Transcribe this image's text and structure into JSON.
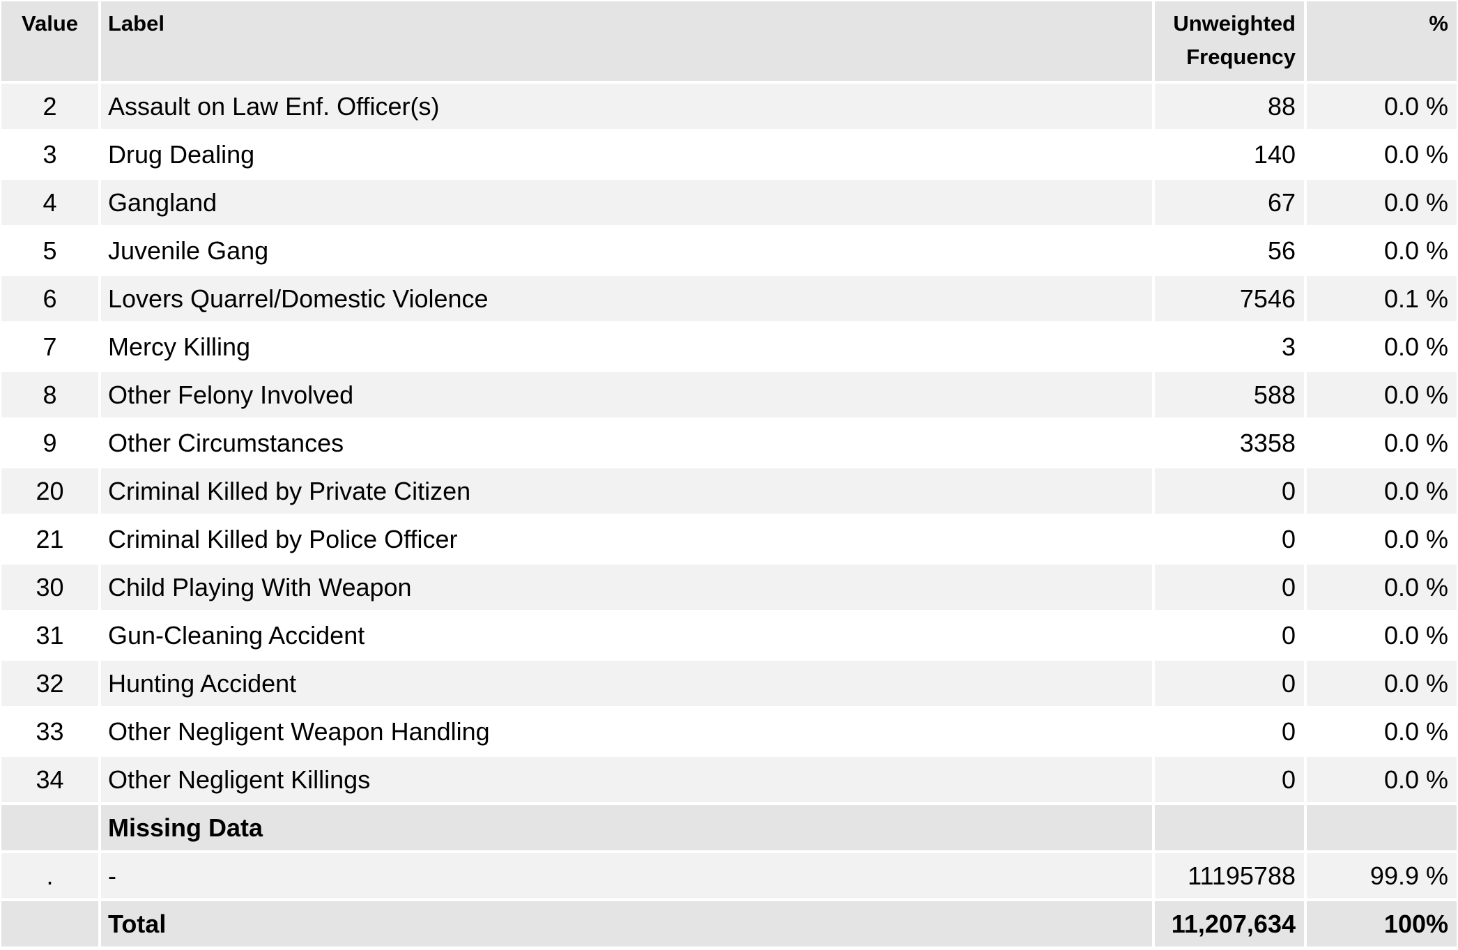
{
  "table": {
    "headers": {
      "value": "Value",
      "label": "Label",
      "frequency_line1": "Unweighted",
      "frequency_line2": "Frequency",
      "percent": "%"
    },
    "rows": [
      {
        "value": "2",
        "label": "Assault on Law Enf. Officer(s)",
        "frequency": "88",
        "percent": "0.0 %"
      },
      {
        "value": "3",
        "label": "Drug Dealing",
        "frequency": "140",
        "percent": "0.0 %"
      },
      {
        "value": "4",
        "label": "Gangland",
        "frequency": "67",
        "percent": "0.0 %"
      },
      {
        "value": "5",
        "label": "Juvenile Gang",
        "frequency": "56",
        "percent": "0.0 %"
      },
      {
        "value": "6",
        "label": "Lovers Quarrel/Domestic Violence",
        "frequency": "7546",
        "percent": "0.1 %"
      },
      {
        "value": "7",
        "label": "Mercy Killing",
        "frequency": "3",
        "percent": "0.0 %"
      },
      {
        "value": "8",
        "label": "Other Felony Involved",
        "frequency": "588",
        "percent": "0.0 %"
      },
      {
        "value": "9",
        "label": "Other Circumstances",
        "frequency": "3358",
        "percent": "0.0 %"
      },
      {
        "value": "20",
        "label": "Criminal Killed by Private Citizen",
        "frequency": "0",
        "percent": "0.0 %"
      },
      {
        "value": "21",
        "label": "Criminal Killed by Police Officer",
        "frequency": "0",
        "percent": "0.0 %"
      },
      {
        "value": "30",
        "label": "Child Playing With Weapon",
        "frequency": "0",
        "percent": "0.0 %"
      },
      {
        "value": "31",
        "label": "Gun-Cleaning Accident",
        "frequency": "0",
        "percent": "0.0 %"
      },
      {
        "value": "32",
        "label": "Hunting Accident",
        "frequency": "0",
        "percent": "0.0 %"
      },
      {
        "value": "33",
        "label": "Other Negligent Weapon Handling",
        "frequency": "0",
        "percent": "0.0 %"
      },
      {
        "value": "34",
        "label": "Other Negligent Killings",
        "frequency": "0",
        "percent": "0.0 %"
      }
    ],
    "missing_section_label": "Missing Data",
    "missing_row": {
      "value": ".",
      "label": "-",
      "frequency": "11195788",
      "percent": "99.9 %"
    },
    "total": {
      "label": "Total",
      "frequency": "11,207,634",
      "percent": "100%"
    }
  },
  "colors": {
    "header_bg": "#e4e4e4",
    "row_alt_bg": "#f2f2f2",
    "row_bg": "#ffffff",
    "gridline": "#ffffff"
  }
}
